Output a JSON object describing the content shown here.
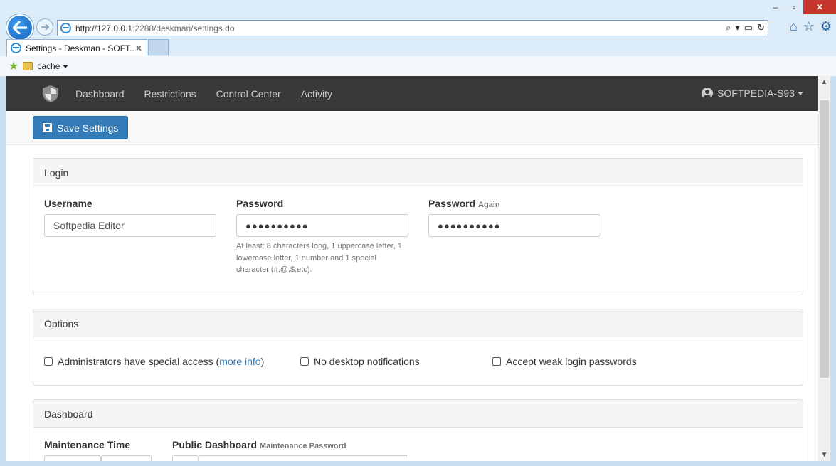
{
  "browser": {
    "url_prefix": "http://127.0.0.1",
    "url_rest": ":2288/deskman/settings.do",
    "tab_title": "Settings - Deskman - SOFT...",
    "fav_folder": "cache"
  },
  "navbar": {
    "items": [
      "Dashboard",
      "Restrictions",
      "Control Center",
      "Activity"
    ],
    "user": "SOFTPEDIA-S93"
  },
  "toolbar": {
    "save_label": "Save Settings"
  },
  "login": {
    "heading": "Login",
    "username_label": "Username",
    "username_value": "Softpedia Editor",
    "password_label": "Password",
    "password_value": "●●●●●●●●●●",
    "password_help": "At least: 8 characters long, 1 uppercase letter, 1 lowercase letter, 1 number and 1 special character (#,@,$,etc).",
    "password_again_label": "Password",
    "password_again_small": "Again",
    "password_again_value": "●●●●●●●●●●"
  },
  "options": {
    "heading": "Options",
    "admin_access_label": "Administrators have special access (",
    "admin_access_link": "more info",
    "admin_access_close": ")",
    "no_notifications_label": "No desktop notifications",
    "weak_passwords_label": "Accept weak login passwords"
  },
  "dashboard": {
    "heading": "Dashboard",
    "maintenance_time_label": "Maintenance Time",
    "public_dashboard_label": "Public Dashboard",
    "public_dashboard_small": "Maintenance Password"
  }
}
